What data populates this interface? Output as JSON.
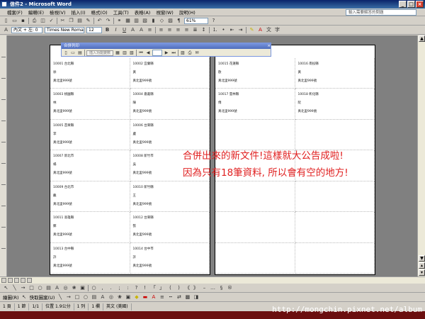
{
  "window": {
    "title": "信件2 - Microsoft Word",
    "minimize": "_",
    "maximize": "□",
    "close": "×"
  },
  "menu": {
    "items": [
      "檔案(F)",
      "編輯(E)",
      "檢視(V)",
      "插入(I)",
      "格式(O)",
      "工具(T)",
      "表格(A)",
      "視窗(W)",
      "說明(H)"
    ],
    "help_placeholder": "輸入需要解答的問題"
  },
  "toolbar": {
    "zoom": "61%",
    "style": "內文 + 左: 0",
    "font": "Times New Roman",
    "font_size": "12"
  },
  "merge_toolbar": {
    "title": "合併列印",
    "insert_field": "插入功能變數",
    "close": "×"
  },
  "labels_left": [
    [
      "10001 台北縣",
      "徐",
      "真北里999號"
    ],
    [
      "10002 宜蘭縣",
      "黃",
      "真北里999號"
    ],
    [
      "10003 桃園縣",
      "林",
      "真北里999號"
    ],
    [
      "10004 嘉義縣",
      "陳",
      "真北里999號"
    ],
    [
      "10005 苗栗縣",
      "李",
      "真北里999號"
    ],
    [
      "10006 台東縣",
      "盧",
      "真北里999號"
    ],
    [
      "10007 新北市",
      "楊",
      "真北里999號"
    ],
    [
      "10008 新竹市",
      "吳",
      "真北里999號"
    ],
    [
      "10009 台北市",
      "戴",
      "真北里999號"
    ],
    [
      "10010 新竹縣",
      "王",
      "真北里999號"
    ],
    [
      "10011 高雄縣",
      "鄭",
      "真北里999號"
    ],
    [
      "10012 台東縣",
      "張",
      "真北里999號"
    ],
    [
      "10013 台中縣",
      "許",
      "真北里999號"
    ],
    [
      "10014 台中市",
      "許",
      "真北里999號"
    ]
  ],
  "labels_right": [
    [
      "10015 花蓮縣",
      "歐",
      "真北里999號"
    ],
    [
      "10016 南投縣",
      "黃",
      "真北里999號"
    ],
    [
      "10017 雲林縣",
      "傅",
      "真北里999號"
    ],
    [
      "10018 彰化縣",
      "阮",
      "真北里999號"
    ]
  ],
  "annotation": {
    "line1": "合併出來的新文件!這樣就大公告成啦!",
    "line2": "因為只有18筆資料, 所以會有空的地方!"
  },
  "drawing": {
    "draw_label": "繪圖(R)",
    "autoshapes_label": "快取圖案(U)"
  },
  "status": {
    "page": "1 頁",
    "section": "1 節",
    "pages": "1/1",
    "position": "位置 1.9公分",
    "line": "1 列",
    "column": "1 欄",
    "language": "英文 (美國)"
  },
  "watermark": "http://mongchin.pixnet.net/album"
}
